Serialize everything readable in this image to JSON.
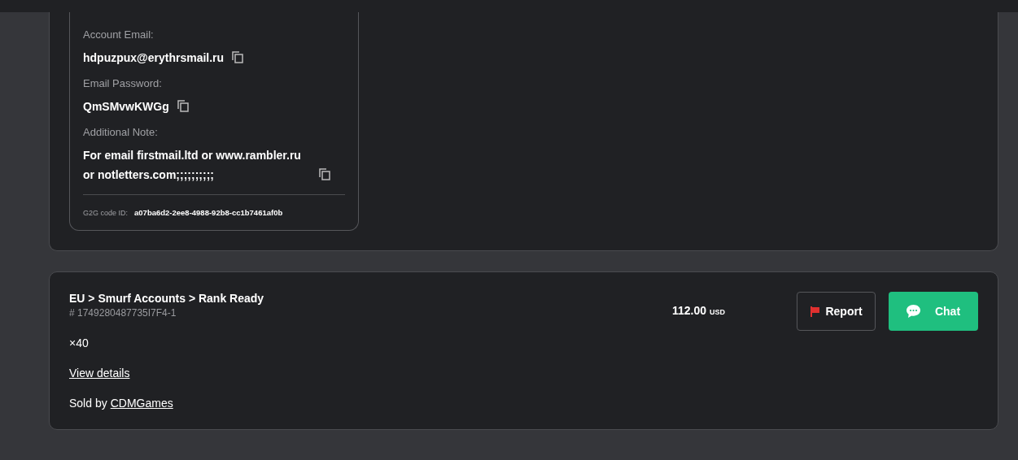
{
  "credentials": {
    "fields": [
      {
        "label": "Account Email:",
        "value": "hdpuzpux@erythrsmail.ru"
      },
      {
        "label": "Email Password:",
        "value": "QmSMvwKWGg"
      },
      {
        "label": "Additional Note:",
        "value": "For email firstmail.ltd or www.rambler.ru or notletters.com;;;;;;;;;;"
      }
    ],
    "code_label": "G2G code ID:",
    "code_value": "a07ba6d2-2ee8-4988-92b8-cc1b7461af0b"
  },
  "order": {
    "title": "EU > Smurf Accounts > Rank Ready",
    "order_number": "# 1749280487735I7F4-1",
    "price": "112.00",
    "currency": "USD",
    "quantity": "×40",
    "details_link": "View details",
    "sold_by_label": "Sold by",
    "seller": "CDMGames",
    "report_button": "Report",
    "chat_button": "Chat"
  }
}
